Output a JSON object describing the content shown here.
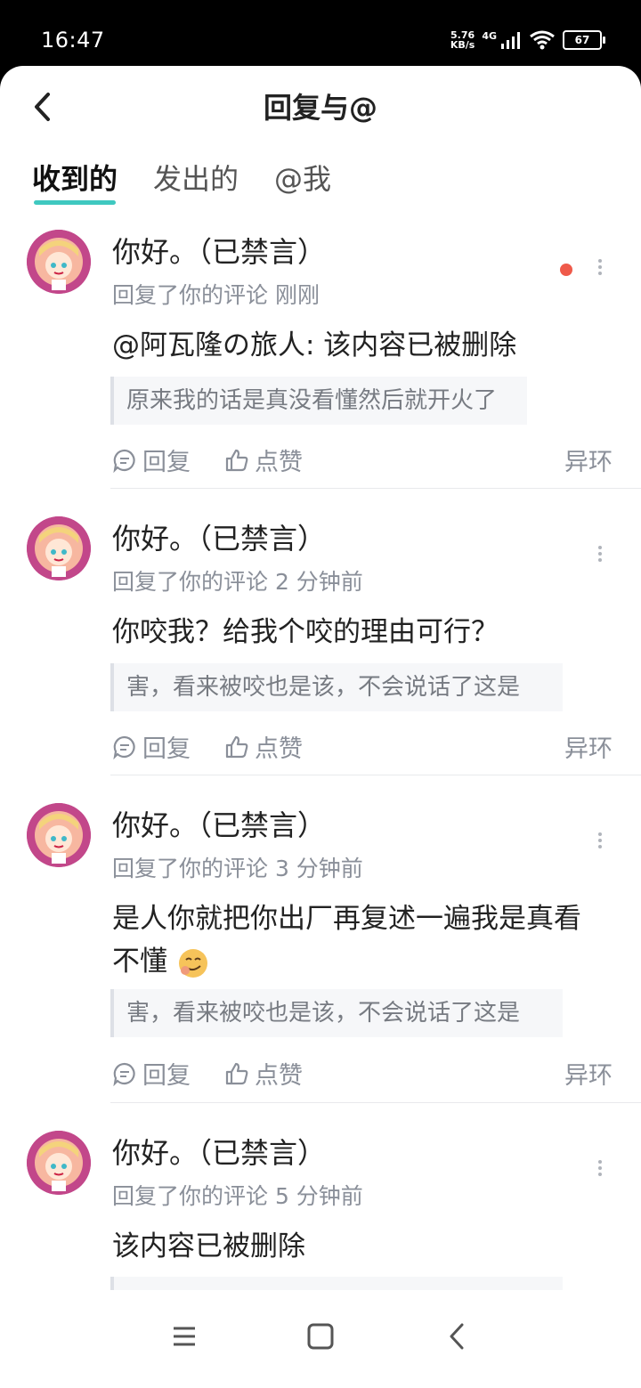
{
  "status_bar": {
    "time": "16:47",
    "net_speed_value": "5.76",
    "net_speed_unit": "KB/s",
    "network": "4G",
    "battery": "67"
  },
  "header": {
    "title": "回复与@"
  },
  "tabs": [
    {
      "label": "收到的",
      "active": true
    },
    {
      "label": "发出的",
      "active": false
    },
    {
      "label": "@我",
      "active": false
    }
  ],
  "items": [
    {
      "username": "你好。（已禁言）",
      "meta": "回复了你的评论 刚刚",
      "content": "@阿瓦隆の旅人: 该内容已被删除",
      "quote": "原来我的话是真没看懂然后就开火了",
      "reply_label": "回复",
      "like_label": "点赞",
      "source": "异环",
      "unread": true
    },
    {
      "username": "你好。（已禁言）",
      "meta": "回复了你的评论 2 分钟前",
      "content": "你咬我？给我个咬的理由可行？",
      "quote": "害，看来被咬也是该，不会说话了这是",
      "reply_label": "回复",
      "like_label": "点赞",
      "source": "异环",
      "unread": false
    },
    {
      "username": "你好。（已禁言）",
      "meta": "回复了你的评论 3 分钟前",
      "content": "是人你就把你出厂再复述一遍我是真看不懂",
      "quote": "害，看来被咬也是该，不会说话了这是",
      "reply_label": "回复",
      "like_label": "点赞",
      "source": "异环",
      "unread": false
    },
    {
      "username": "你好。（已禁言）",
      "meta": "回复了你的评论 5 分钟前",
      "content": "该内容已被删除",
      "unread": false
    }
  ],
  "colors": {
    "accent": "#3fc8c0",
    "unread_dot": "#ef5a4a",
    "avatar_bg": "#c2478a"
  }
}
